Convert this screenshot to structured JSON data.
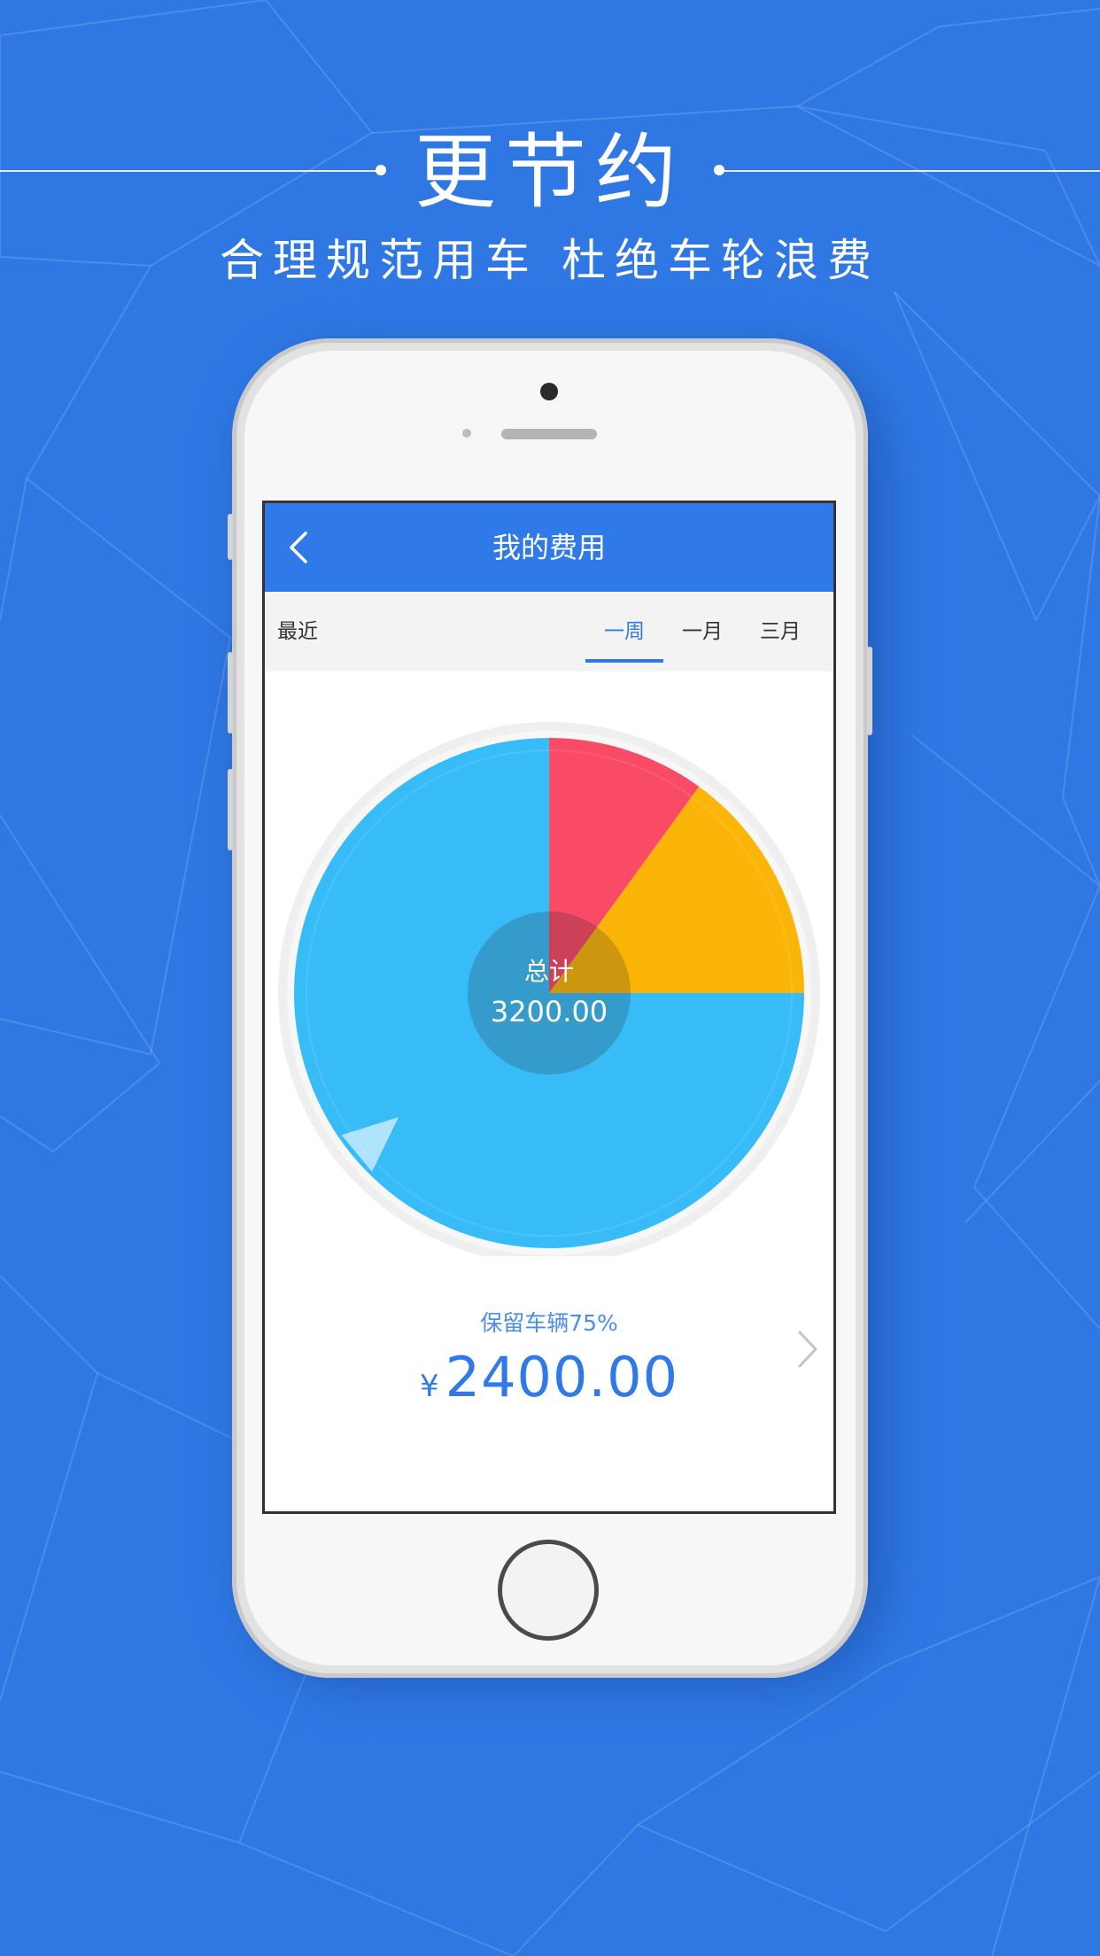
{
  "promo": {
    "headline": "更节约",
    "subheadline": "合理规范用车 杜绝车轮浪费"
  },
  "screen": {
    "nav": {
      "back_icon": "chevron-left-icon",
      "title": "我的费用"
    },
    "period": {
      "label": "最近",
      "tabs": [
        {
          "label": "一周",
          "active": true
        },
        {
          "label": "一月",
          "active": false
        },
        {
          "label": "三月",
          "active": false
        }
      ]
    },
    "chart": {
      "center_title": "总计",
      "center_value": "3200.00"
    },
    "selection": {
      "label": "保留车辆75%",
      "currency": "¥",
      "amount": "2400.00",
      "next_icon": "chevron-right-icon"
    }
  },
  "colors": {
    "background": "#2f78e4",
    "accent": "#3079e8",
    "slice_blue": "#38bcf8",
    "slice_red": "#f94a66",
    "slice_yellow": "#fbb508"
  },
  "chart_data": {
    "type": "pie",
    "categories": [
      "",
      "",
      ""
    ],
    "values": [
      75,
      10,
      15
    ],
    "unit": "%",
    "total": 3200.0,
    "colors": [
      "#38bcf8",
      "#f94a66",
      "#fbb508"
    ]
  }
}
